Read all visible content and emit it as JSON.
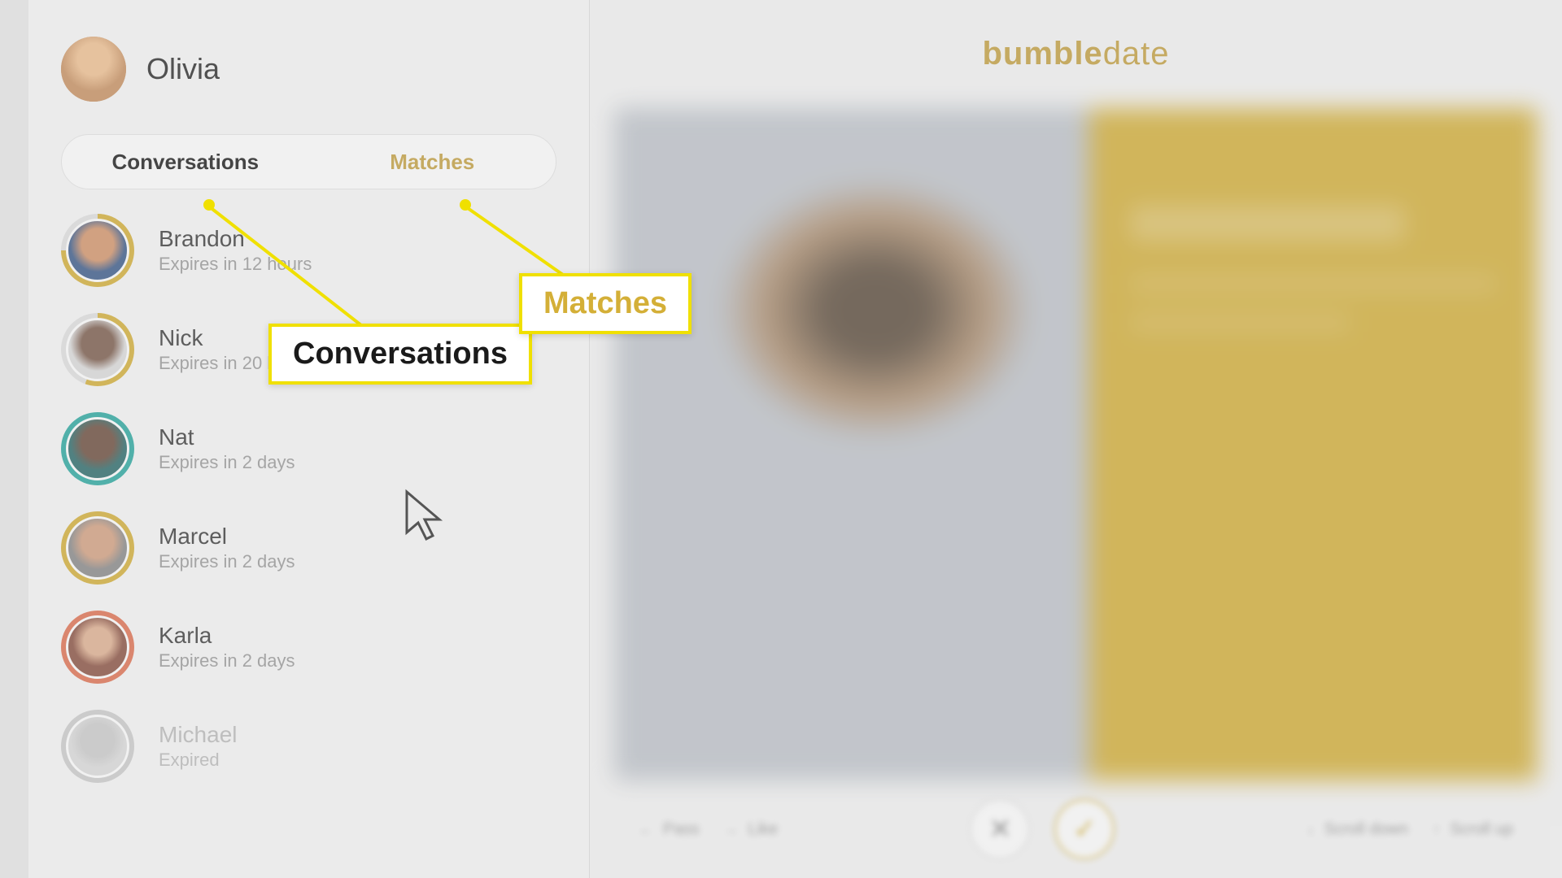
{
  "user": {
    "name": "Olivia"
  },
  "tabs": {
    "conversations": "Conversations",
    "matches": "Matches"
  },
  "conversations": [
    {
      "name": "Brandon",
      "status": "Expires in 12 hours",
      "ring": "gold",
      "face": "face1",
      "expired": false
    },
    {
      "name": "Nick",
      "status": "Expires in 20 hours",
      "ring": "gold-partial",
      "face": "face2",
      "expired": false
    },
    {
      "name": "Nat",
      "status": "Expires in 2 days",
      "ring": "teal",
      "face": "face3",
      "expired": false
    },
    {
      "name": "Marcel",
      "status": "Expires in 2 days",
      "ring": "gold-full",
      "face": "face4",
      "expired": false
    },
    {
      "name": "Karla",
      "status": "Expires in 2 days",
      "ring": "orange",
      "face": "face5",
      "expired": false
    },
    {
      "name": "Michael",
      "status": "Expired",
      "ring": "grey",
      "face": "face6",
      "expired": true
    }
  ],
  "brand": {
    "bold": "bumble",
    "light": "date"
  },
  "actions": {
    "pass": "Pass",
    "like": "Like",
    "scroll_down": "Scroll down",
    "scroll_up": "Scroll up"
  },
  "annotations": {
    "conversations": "Conversations",
    "matches": "Matches"
  }
}
